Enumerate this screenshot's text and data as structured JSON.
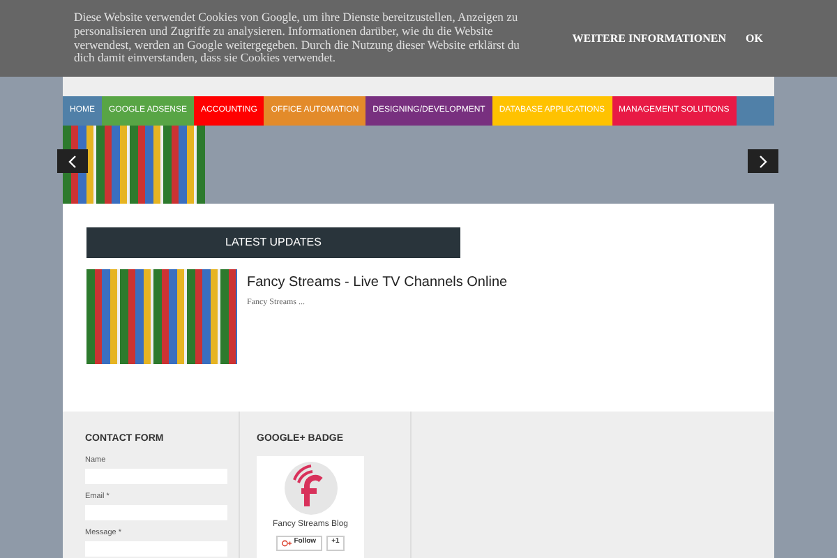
{
  "cookie_bar": {
    "message": "Diese Website verwendet Cookies von Google, um ihre Dienste bereitzustellen, Anzeigen zu personalisieren und Zugriffe zu analysieren. Informationen darüber, wie du die Website verwendest, werden an Google weitergegeben. Durch die Nutzung dieser Website erklärst du dich damit einverstanden, dass sie Cookies verwendet.",
    "buttons": [
      "WEITERE INFORMATIONEN",
      "OK"
    ]
  },
  "nav": [
    {
      "label": "HOME",
      "color": "#5080a8"
    },
    {
      "label": "GOOGLE ADSENSE",
      "color": "#58a545"
    },
    {
      "label": "ACCOUNTING",
      "color": "#ff0000"
    },
    {
      "label": "OFFICE AUTOMATION",
      "color": "#e38b2a"
    },
    {
      "label": "DESIGNING/DEVELOPMENT",
      "color": "#78307f"
    },
    {
      "label": "DATABASE APPLICATIONS",
      "color": "#ffc200"
    },
    {
      "label": "MANAGEMENT SOLUTIONS",
      "color": "#e81a45"
    }
  ],
  "latest": {
    "title": "LATEST UPDATES",
    "posts": [
      {
        "title": "Fancy Streams - Live TV Channels Online",
        "snippet": "Fancy Streams ..."
      }
    ]
  },
  "contact_form": {
    "title": "CONTACT FORM",
    "fields": [
      "Name",
      "Email *",
      "Message *"
    ]
  },
  "badge": {
    "title": "GOOGLE+ BADGE",
    "name": "Fancy Streams Blog",
    "follow": "Follow",
    "plus": "+1"
  }
}
